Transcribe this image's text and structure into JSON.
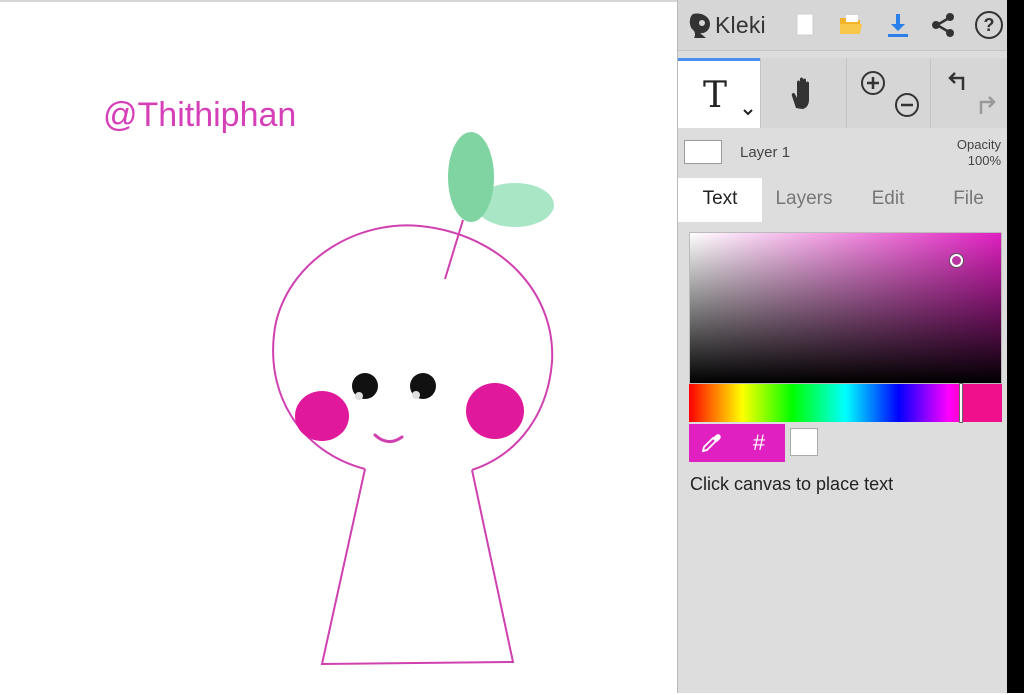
{
  "canvas": {
    "watermark_text": "@Thithiphan",
    "drawing_description_colors": {
      "outline": "#d040b0",
      "cheeks": "#e0189c",
      "leaf": "#7fd4a2",
      "eyes": "#111111"
    }
  },
  "toolbar": {
    "app_name": "Kleki",
    "icons": [
      "kleki-logo-icon",
      "new-document-icon",
      "open-folder-icon",
      "download-icon",
      "share-icon",
      "help-icon"
    ]
  },
  "tools": {
    "text_tool_glyph": "T",
    "icons": [
      "chevron-down-icon",
      "hand-icon",
      "zoom-in-icon",
      "zoom-out-icon",
      "undo-icon",
      "redo-icon"
    ]
  },
  "layer": {
    "name": "Layer 1",
    "opacity_label": "Opacity",
    "opacity_value": "100%"
  },
  "tabs": [
    {
      "label": "Text",
      "active": true
    },
    {
      "label": "Layers",
      "active": false
    },
    {
      "label": "Edit",
      "active": false
    },
    {
      "label": "File",
      "active": false
    }
  ],
  "color": {
    "current_hex": "#e020c0",
    "hue_hex": "#ff00cc",
    "secondary_hex": "#ffffff",
    "hash_label": "#"
  },
  "hint_text": "Click canvas to place text"
}
